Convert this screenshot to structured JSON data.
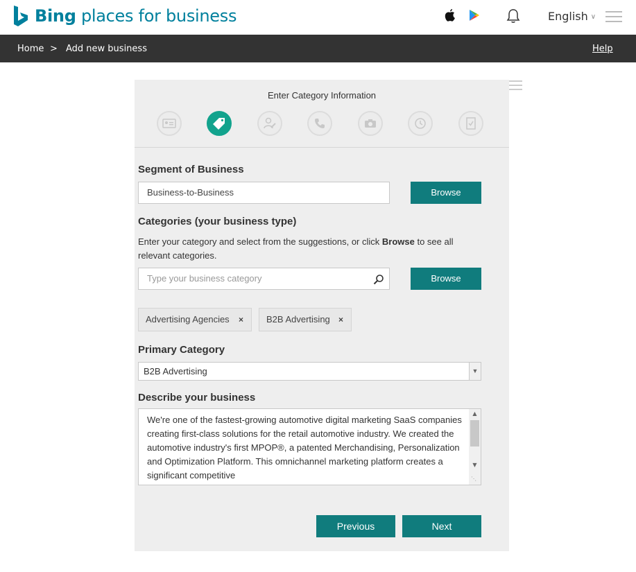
{
  "header": {
    "brand_bold": "Bing",
    "brand_rest": "places for business",
    "language": "English",
    "colors": {
      "brand": "#00809d",
      "accent": "#107c7d",
      "step_active": "#12a38d"
    },
    "icons": [
      "bing-logo-icon",
      "apple-icon",
      "google-play-icon",
      "bell-icon",
      "menu-icon"
    ]
  },
  "breadcrumb": {
    "home": "Home",
    "separator": ">",
    "current": "Add new business",
    "help": "Help"
  },
  "wizard": {
    "title": "Enter Category Information",
    "steps": [
      {
        "icon": "id-card-icon"
      },
      {
        "icon": "tag-icon",
        "active": true
      },
      {
        "icon": "person-edit-icon"
      },
      {
        "icon": "phone-icon"
      },
      {
        "icon": "camera-icon"
      },
      {
        "icon": "clock-icon"
      },
      {
        "icon": "document-check-icon"
      }
    ]
  },
  "segment": {
    "label": "Segment of Business",
    "value": "Business-to-Business",
    "browse": "Browse"
  },
  "categories": {
    "label": "Categories (your business type)",
    "help_pre": "Enter your category and select from the suggestions, or click ",
    "help_bold": "Browse",
    "help_post": " to see all relevant categories.",
    "placeholder": "Type your business category",
    "browse": "Browse",
    "tags": [
      {
        "label": "Advertising Agencies",
        "remove": "×"
      },
      {
        "label": "B2B Advertising",
        "remove": "×"
      }
    ]
  },
  "primary": {
    "label": "Primary Category",
    "selected": "B2B Advertising"
  },
  "describe": {
    "label": "Describe your business",
    "text": "We're one of the fastest-growing automotive digital marketing SaaS companies creating first-class solutions for the retail automotive industry. We created the automotive industry's first MPOP®, a patented Merchandising, Personalization and Optimization Platform. This omnichannel marketing platform creates a significant competitive"
  },
  "footer": {
    "previous": "Previous",
    "next": "Next"
  }
}
